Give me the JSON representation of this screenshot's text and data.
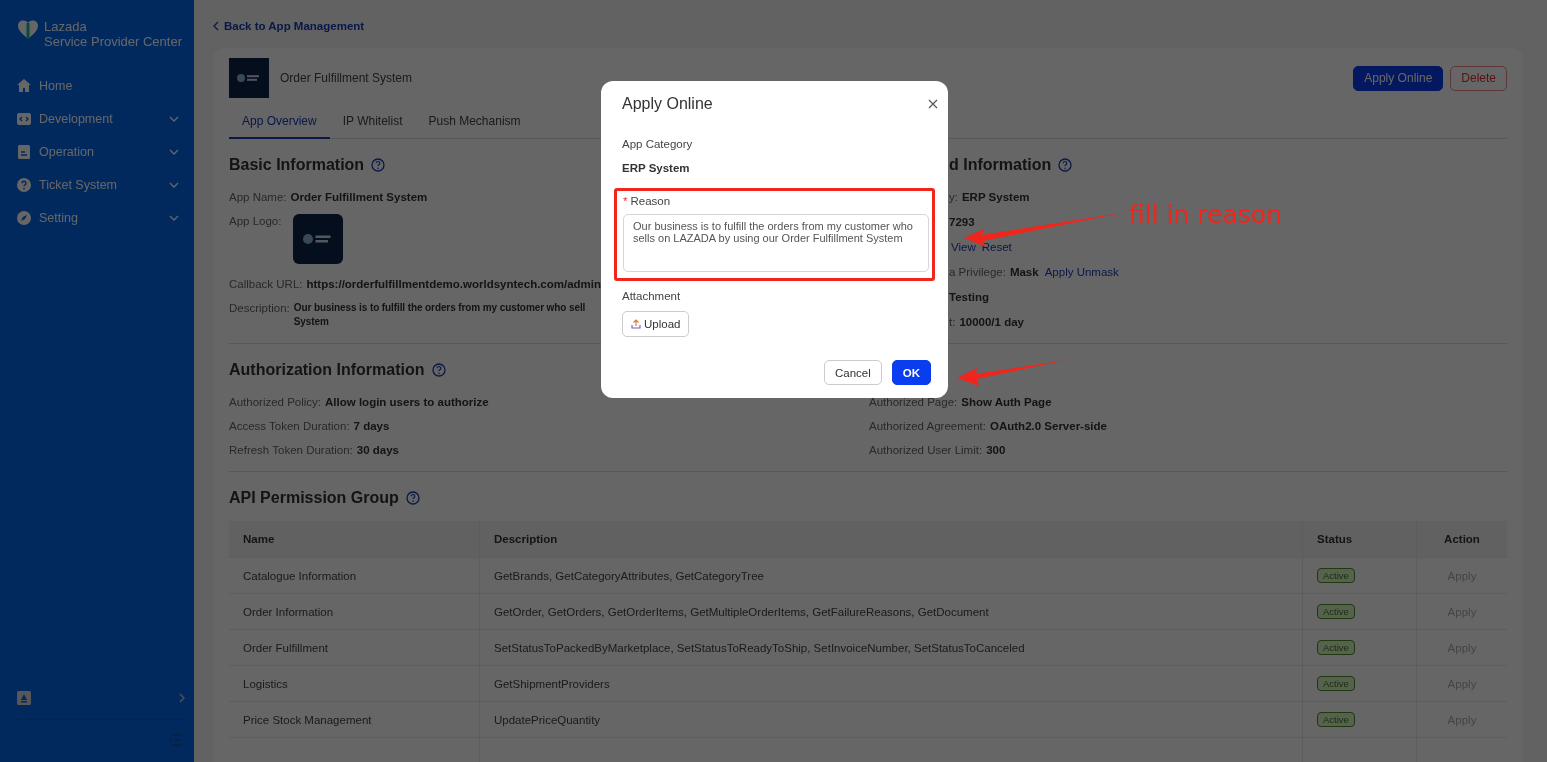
{
  "sidebar": {
    "brand": [
      "Lazada",
      "Service Provider Center"
    ],
    "menu": [
      {
        "label": "Home",
        "kind": "home",
        "has_submenu": false
      },
      {
        "label": "Development",
        "kind": "code",
        "has_submenu": true
      },
      {
        "label": "Operation",
        "kind": "doc",
        "has_submenu": true
      },
      {
        "label": "Ticket System",
        "kind": "help",
        "has_submenu": true
      },
      {
        "label": "Setting",
        "kind": "compass",
        "has_submenu": true
      }
    ]
  },
  "back_link": "Back to App Management",
  "app": {
    "name": "Order Fulfillment System"
  },
  "header_buttons": [
    {
      "label": "Apply Online",
      "kind": "primary"
    },
    {
      "label": "Delete",
      "kind": "danger"
    }
  ],
  "tabs": [
    {
      "label": "App Overview",
      "selected": true
    },
    {
      "label": "IP Whitelist",
      "selected": false
    },
    {
      "label": "Push Mechanism",
      "selected": false
    }
  ],
  "sections": [
    {
      "title": "Basic Information",
      "right_title": "d Information",
      "left": [
        {
          "label": "App Name:",
          "value": "Order Fulfillment System"
        },
        {
          "label": "App Logo:",
          "kind": "logo"
        },
        {
          "label": "Callback URL:",
          "value": "https://orderfulfillmentdemo.worldsyntech.com/admin"
        },
        {
          "label": "Description:",
          "lines": [
            "Our business is to fulfill the orders from my customer who sell",
            "System"
          ]
        }
      ],
      "right": [
        {
          "label": "y:",
          "value": "ERP System"
        },
        {
          "value": "7293"
        },
        {
          "links": [
            "View",
            "Reset"
          ]
        },
        {
          "label": "a Privilege:",
          "value": "Mask",
          "links": [
            "Apply Unmask"
          ]
        },
        {
          "value": "Testing"
        },
        {
          "label": "t:",
          "value": "10000/1 day"
        }
      ]
    },
    {
      "title": "Authorization Information",
      "left": [
        {
          "label": "Authorized Policy:",
          "value": "Allow login users to authorize"
        },
        {
          "label": "Access Token Duration:",
          "value": "7 days"
        },
        {
          "label": "Refresh Token Duration:",
          "value": "30 days"
        }
      ],
      "right": [
        {
          "label": "Authorized Page:",
          "value": "Show Auth Page"
        },
        {
          "label": "Authorized Agreement:",
          "value": "OAuth2.0 Server-side"
        },
        {
          "label": "Authorized User Limit:",
          "value": "300"
        }
      ]
    }
  ],
  "api": {
    "title": "API Permission Group",
    "columns": [
      "Name",
      "Description",
      "Status",
      "Action"
    ],
    "rows": [
      {
        "name": "Catalogue Information",
        "description": "GetBrands, GetCategoryAttributes, GetCategoryTree",
        "status": "Active",
        "action": "Apply",
        "disabled": true
      },
      {
        "name": "Order Information",
        "description": "GetOrder, GetOrders, GetOrderItems, GetMultipleOrderItems, GetFailureReasons, GetDocument",
        "status": "Active",
        "action": "Apply",
        "disabled": true
      },
      {
        "name": "Order Fulfillment",
        "description": "SetStatusToPackedByMarketplace, SetStatusToReadyToShip, SetInvoiceNumber, SetStatusToCanceled",
        "status": "Active",
        "action": "Apply",
        "disabled": true
      },
      {
        "name": "Logistics",
        "description": "GetShipmentProviders",
        "status": "Active",
        "action": "Apply",
        "disabled": true
      },
      {
        "name": "Price Stock Management",
        "description": "UpdatePriceQuantity",
        "status": "Active",
        "action": "Apply",
        "disabled": true
      }
    ]
  },
  "modal": {
    "title": "Apply Online",
    "category_label": "App Category",
    "category_value": "ERP System",
    "reason": {
      "label": "Reason",
      "required_mark": "*",
      "value": "Our business is to fulfill the orders from my customer who sells on LAZADA by using our Order Fulfillment System"
    },
    "attachment_label": "Attachment",
    "upload_label": "Upload",
    "buttons": [
      {
        "label": "Cancel",
        "kind": "default"
      },
      {
        "label": "OK",
        "kind": "primary"
      }
    ]
  },
  "annotation": {
    "text": "fill in reason"
  }
}
